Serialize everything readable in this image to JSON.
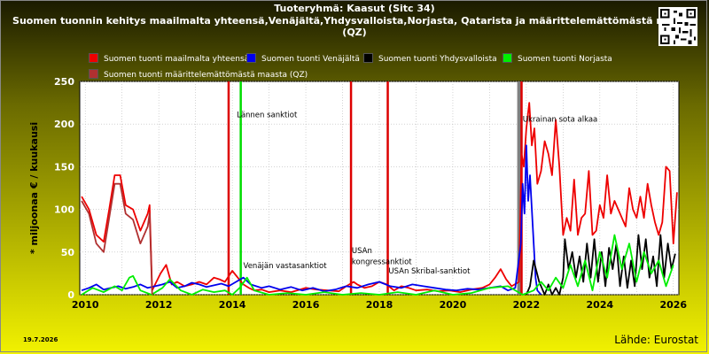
{
  "header": {
    "title": "Tuoteryhmä: Kaasut (Sitc 34)",
    "subtitle": "Suomen tuonnin kehitys maailmalta yhteensä,Venäjältä,Yhdysvalloista,Norjasta, Qatarista ja määrittelemättömästä maasta (QZ)"
  },
  "footer": {
    "date": "19.7.2026",
    "source": "Lähde: Eurostat"
  },
  "chart_data": {
    "type": "line",
    "ylabel": "* miljoonaa € / kuukausi",
    "xlim": [
      2009.85,
      2026.15
    ],
    "ylim": [
      0,
      250
    ],
    "yticks": [
      0,
      50,
      100,
      150,
      200,
      250
    ],
    "xticks": [
      "2010",
      "2012",
      "2014",
      "2016",
      "2018",
      "2020",
      "2022",
      "2024",
      "2026"
    ],
    "grid": true,
    "legend_position": "top",
    "colors": {
      "plot_bg": "#ffffff",
      "grid": "#b8b8b8",
      "marker": "#dd0000",
      "marker_green": "#00dd00",
      "marker_gray": "#808080"
    },
    "series": [
      {
        "name": "Suomen tuonti maailmalta yhteensä",
        "color": "#ee0000",
        "x": [
          2009.9,
          2010.1,
          2010.3,
          2010.5,
          2010.65,
          2010.8,
          2010.95,
          2011.1,
          2011.3,
          2011.5,
          2011.7,
          2011.75,
          2011.82,
          2011.9,
          2012.05,
          2012.2,
          2012.35,
          2012.5,
          2012.7,
          2012.9,
          2013.1,
          2013.3,
          2013.5,
          2013.65,
          2013.8,
          2014.0,
          2014.15,
          2014.3,
          2014.45,
          2014.6,
          2014.8,
          2015.0,
          2015.3,
          2015.6,
          2016.0,
          2016.3,
          2016.6,
          2016.9,
          2017.1,
          2017.3,
          2017.4,
          2017.6,
          2017.8,
          2018.0,
          2018.2,
          2018.4,
          2018.6,
          2018.8,
          2019.0,
          2019.3,
          2019.6,
          2019.9,
          2020.2,
          2020.5,
          2020.8,
          2021.0,
          2021.15,
          2021.3,
          2021.45,
          2021.6,
          2021.8,
          2021.87,
          2021.93,
          2022.0,
          2022.08,
          2022.15,
          2022.22,
          2022.3,
          2022.4,
          2022.5,
          2022.6,
          2022.7,
          2022.8,
          2022.9,
          2023.0,
          2023.1,
          2023.2,
          2023.3,
          2023.4,
          2023.5,
          2023.6,
          2023.7,
          2023.8,
          2023.9,
          2024.0,
          2024.1,
          2024.2,
          2024.3,
          2024.4,
          2024.5,
          2024.6,
          2024.7,
          2024.8,
          2024.9,
          2025.0,
          2025.1,
          2025.2,
          2025.3,
          2025.4,
          2025.5,
          2025.6,
          2025.7,
          2025.8,
          2025.9,
          2026.0,
          2026.1
        ],
        "values": [
          115,
          100,
          70,
          62,
          100,
          140,
          140,
          105,
          100,
          75,
          95,
          105,
          5,
          12,
          25,
          35,
          12,
          15,
          10,
          12,
          15,
          12,
          20,
          18,
          15,
          28,
          20,
          12,
          8,
          5,
          6,
          3,
          5,
          3,
          8,
          6,
          5,
          4,
          10,
          15,
          12,
          8,
          10,
          15,
          12,
          5,
          10,
          8,
          5,
          6,
          4,
          5,
          3,
          6,
          8,
          12,
          20,
          30,
          18,
          10,
          15,
          165,
          150,
          195,
          225,
          175,
          195,
          130,
          145,
          180,
          165,
          140,
          205,
          150,
          70,
          90,
          75,
          135,
          70,
          90,
          95,
          145,
          70,
          75,
          105,
          90,
          140,
          95,
          110,
          100,
          90,
          80,
          125,
          100,
          90,
          115,
          90,
          130,
          105,
          85,
          70,
          85,
          150,
          145,
          60,
          120
        ]
      },
      {
        "name": "Suomen tuonti Venäjältä",
        "color": "#0000ee",
        "x": [
          2009.9,
          2010.1,
          2010.3,
          2010.5,
          2010.7,
          2010.9,
          2011.1,
          2011.3,
          2011.5,
          2011.7,
          2011.9,
          2012.1,
          2012.3,
          2012.5,
          2012.7,
          2012.9,
          2013.1,
          2013.3,
          2013.5,
          2013.7,
          2013.9,
          2014.1,
          2014.3,
          2014.5,
          2014.8,
          2015.0,
          2015.3,
          2015.6,
          2015.9,
          2016.2,
          2016.5,
          2016.8,
          2017.1,
          2017.4,
          2017.7,
          2018.0,
          2018.3,
          2018.6,
          2018.9,
          2019.2,
          2019.5,
          2019.8,
          2020.1,
          2020.4,
          2020.7,
          2021.0,
          2021.3,
          2021.5,
          2021.7,
          2021.85,
          2021.9,
          2021.95,
          2022.0,
          2022.05,
          2022.1,
          2022.15,
          2022.2,
          2022.25,
          2022.3,
          2022.4
        ],
        "values": [
          5,
          8,
          12,
          6,
          8,
          10,
          7,
          9,
          12,
          8,
          10,
          12,
          15,
          8,
          10,
          14,
          12,
          9,
          11,
          13,
          10,
          15,
          20,
          12,
          8,
          10,
          6,
          9,
          5,
          8,
          4,
          6,
          10,
          8,
          12,
          15,
          10,
          8,
          12,
          10,
          8,
          6,
          5,
          7,
          6,
          8,
          10,
          5,
          8,
          60,
          130,
          95,
          175,
          110,
          140,
          100,
          60,
          20,
          5,
          0
        ]
      },
      {
        "name": "Suomen tuonti Yhdysvalloista",
        "color": "#000000",
        "x": [
          2022.0,
          2022.1,
          2022.2,
          2022.35,
          2022.5,
          2022.6,
          2022.7,
          2022.8,
          2022.9,
          2023.0,
          2023.05,
          2023.15,
          2023.25,
          2023.35,
          2023.45,
          2023.55,
          2023.65,
          2023.75,
          2023.85,
          2023.95,
          2024.05,
          2024.15,
          2024.25,
          2024.35,
          2024.45,
          2024.55,
          2024.65,
          2024.75,
          2024.85,
          2024.95,
          2025.05,
          2025.15,
          2025.25,
          2025.35,
          2025.45,
          2025.55,
          2025.65,
          2025.75,
          2025.85,
          2025.95,
          2026.05
        ],
        "values": [
          0,
          10,
          40,
          15,
          0,
          12,
          0,
          8,
          0,
          20,
          65,
          30,
          50,
          20,
          45,
          15,
          60,
          20,
          65,
          15,
          50,
          10,
          55,
          30,
          60,
          10,
          45,
          8,
          40,
          10,
          70,
          30,
          65,
          20,
          45,
          10,
          70,
          20,
          60,
          30,
          48
        ]
      },
      {
        "name": "Suomen tuonti Norjasta",
        "color": "#00ee00",
        "x": [
          2009.9,
          2010.2,
          2010.5,
          2010.8,
          2011.0,
          2011.2,
          2011.3,
          2011.5,
          2011.8,
          2012.1,
          2012.3,
          2012.6,
          2012.9,
          2013.2,
          2013.5,
          2013.8,
          2014.0,
          2014.2,
          2014.4,
          2014.6,
          2015.0,
          2015.5,
          2016.0,
          2016.5,
          2017.0,
          2017.5,
          2018.0,
          2018.5,
          2019.0,
          2019.5,
          2020.0,
          2020.5,
          2021.0,
          2021.5,
          2021.9,
          2022.2,
          2022.4,
          2022.6,
          2022.8,
          2023.0,
          2023.2,
          2023.4,
          2023.6,
          2023.8,
          2024.0,
          2024.2,
          2024.4,
          2024.6,
          2024.8,
          2025.0,
          2025.2,
          2025.4,
          2025.6,
          2025.8,
          2026.0
        ],
        "values": [
          0,
          8,
          3,
          10,
          5,
          20,
          22,
          5,
          0,
          8,
          18,
          5,
          0,
          6,
          3,
          5,
          0,
          8,
          20,
          5,
          0,
          2,
          0,
          3,
          0,
          2,
          0,
          3,
          0,
          5,
          0,
          2,
          8,
          10,
          0,
          5,
          15,
          5,
          20,
          8,
          35,
          10,
          40,
          5,
          50,
          20,
          70,
          30,
          60,
          15,
          50,
          25,
          40,
          10,
          35
        ]
      },
      {
        "name": "Suomen tuonti määrittelemättömästä maasta (QZ)",
        "color": "#b03030",
        "x": [
          2009.9,
          2010.1,
          2010.3,
          2010.5,
          2010.65,
          2010.8,
          2010.95,
          2011.1,
          2011.3,
          2011.5,
          2011.7,
          2011.75,
          2011.82
        ],
        "values": [
          110,
          95,
          60,
          50,
          90,
          130,
          130,
          95,
          88,
          60,
          80,
          95,
          0
        ]
      }
    ],
    "annotations": [
      {
        "text": "Lännen sanktiot",
        "x": 2014.12,
        "y": 208,
        "color": "green"
      },
      {
        "text": "Venäjän vastasanktiot",
        "x": 2014.3,
        "y": 31
      },
      {
        "text": "USAn",
        "x": 2017.25,
        "y": 49
      },
      {
        "text": "kongressanktiot",
        "x": 2017.25,
        "y": 36
      },
      {
        "text": "USAn Skribal-sanktiot",
        "x": 2018.25,
        "y": 25
      },
      {
        "text": "Ukrainan sota alkaa",
        "x": 2021.9,
        "y": 203
      }
    ],
    "event_lines": [
      {
        "x": 2013.9,
        "color": "red"
      },
      {
        "x": 2014.23,
        "color": "green"
      },
      {
        "x": 2017.23,
        "color": "red"
      },
      {
        "x": 2018.23,
        "color": "red"
      },
      {
        "x": 2021.8,
        "color": "gray"
      },
      {
        "x": 2021.87,
        "color": "red"
      }
    ]
  }
}
